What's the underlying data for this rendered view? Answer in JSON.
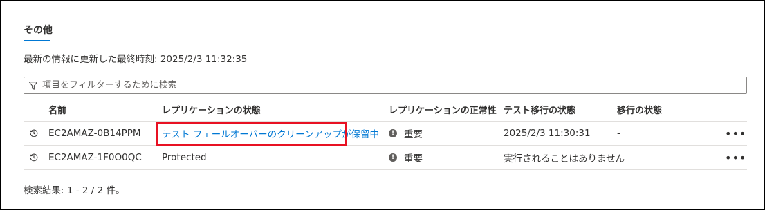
{
  "section": {
    "title": "その他"
  },
  "last_updated": "最新の情報に更新した最終時刻: 2025/2/3 11:32:35",
  "filter": {
    "placeholder": "項目をフィルターするために検索",
    "icon": "filter-icon"
  },
  "columns": {
    "name": "名前",
    "replication_state": "レプリケーションの状態",
    "replication_health": "レプリケーションの正常性",
    "test_migration_state": "テスト移行の状態",
    "migration_state": "移行の状態"
  },
  "rows": [
    {
      "icon": "history-icon",
      "name": "EC2AMAZ-0B14PPM",
      "replication_state": "テスト フェールオーバーのクリーンアップが保留中",
      "replication_health_icon": "info-icon",
      "replication_health": "重要",
      "test_migration_state": "2025/2/3 11:30:31",
      "migration_state": "-",
      "more": "•••"
    },
    {
      "icon": "history-icon",
      "name": "EC2AMAZ-1F0O0QC",
      "replication_state": "Protected",
      "replication_health_icon": "info-icon",
      "replication_health": "重要",
      "test_migration_state": "実行されることはありません",
      "migration_state": "-",
      "more": "•••"
    }
  ],
  "results": "検索結果: 1 - 2 / 2 件。",
  "colors": {
    "accent": "#0078d4",
    "highlight": "#e81123"
  }
}
